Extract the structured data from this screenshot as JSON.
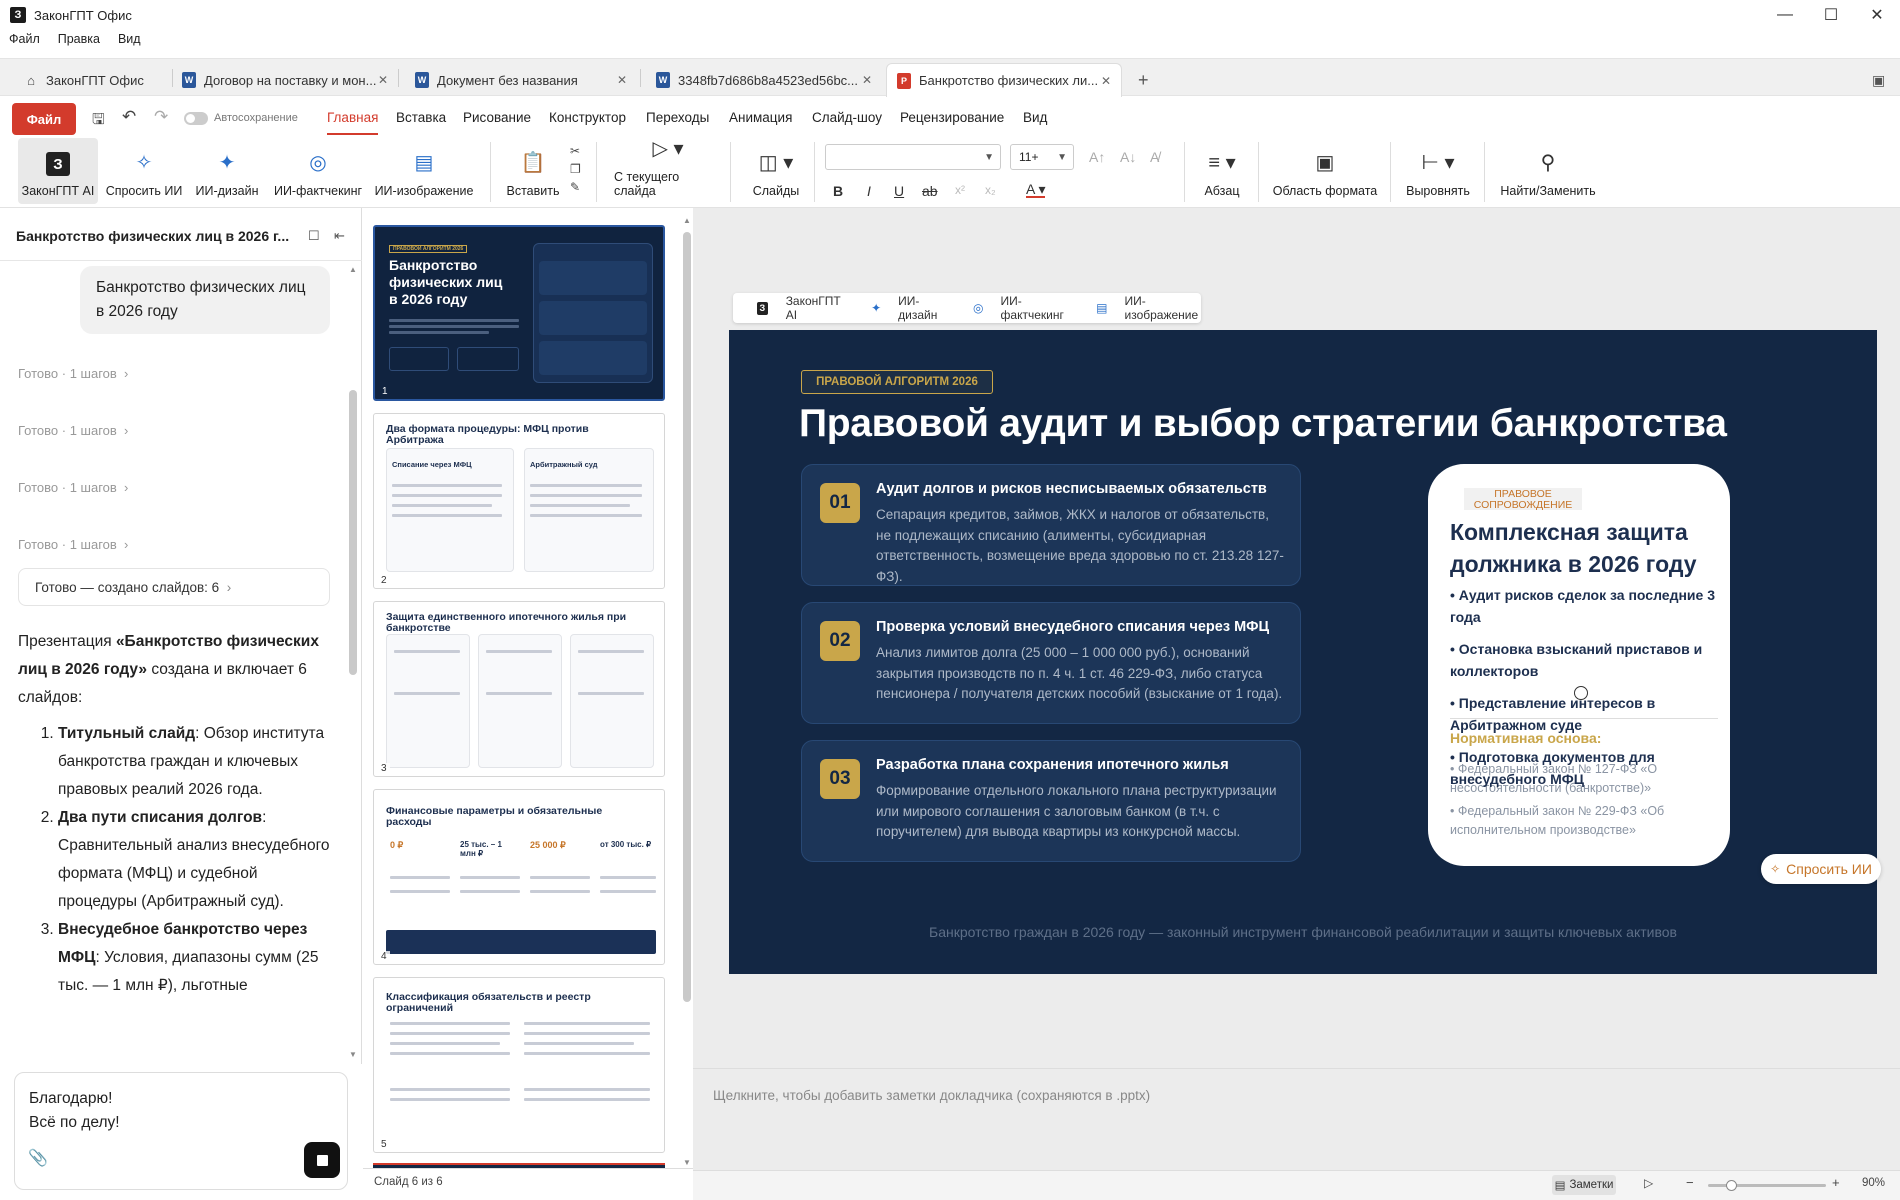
{
  "window": {
    "logo": "З",
    "title": "ЗаконГПТ Офис"
  },
  "menu": [
    "Файл",
    "Правка",
    "Вид"
  ],
  "tabs": [
    {
      "label": "ЗаконГПТ Офис",
      "icon": "home-icon"
    },
    {
      "label": "Договор на поставку и мон...",
      "icon": "word-doc-icon"
    },
    {
      "label": "Документ без названия",
      "icon": "word-doc-icon"
    },
    {
      "label": "3348fb7d686b8a4523ed56bc...",
      "icon": "word-doc-icon"
    },
    {
      "label": "Банкротство физических ли...",
      "icon": "presentation-icon"
    }
  ],
  "ribbon_top": {
    "file": "Файл",
    "autosave": "Автосохранение",
    "tabs": [
      "Главная",
      "Вставка",
      "Рисование",
      "Конструктор",
      "Переходы",
      "Анимация",
      "Слайд-шоу",
      "Рецензирование",
      "Вид"
    ]
  },
  "ribbon": {
    "ai_logo": "З",
    "zakon_ai": "ЗаконГПТ AI",
    "ask_ai": "Спросить ИИ",
    "ai_design": "ИИ-дизайн",
    "ai_factcheck": "ИИ-фактчекинг",
    "ai_image": "ИИ-изображение",
    "paste": "Вставить",
    "from_current": "С текущего слайда",
    "slides": "Слайды",
    "font_size": "11+",
    "paragraph": "Абзац",
    "format_area": "Область формата",
    "align": "Выровнять",
    "find_replace": "Найти/Заменить"
  },
  "chat": {
    "title": "Банкротство физических лиц в 2026 г...",
    "user_message": "Банкротство физических лиц в 2026 году",
    "steps": [
      "Готово · 1 шагов",
      "Готово · 1 шагов",
      "Готово · 1 шагов",
      "Готово · 1 шагов"
    ],
    "done": "Готово — создано слайдов: 6",
    "intro_before": "Презентация ",
    "intro_bold": "«Банкротство физических лиц в 2026 году»",
    "intro_after": " создана и включает 6 слайдов:",
    "items": [
      {
        "bold": "Титульный слайд",
        "text": ": Обзор института банкротства граждан и ключевых правовых реалий 2026 года."
      },
      {
        "bold": "Два пути списания долгов",
        "text": ": Сравнительный анализ внесудебного формата (МФЦ) и судебной процедуры (Арбитражный суд)."
      },
      {
        "bold": "Внесудебное банкротство через МФЦ",
        "text": ": Условия, диапазоны сумм (25 тыс. — 1 млн ₽), льготные"
      }
    ],
    "input_line1": "Благодарю!",
    "input_line2": "Всё по делу!"
  },
  "thumbnails": {
    "numbers": [
      "1",
      "2",
      "3",
      "4",
      "5"
    ],
    "t1_badge": "ПРАВОВОЙ АЛГОРИТМ 2026",
    "t1_title": "Банкротство физических лиц в 2026 году",
    "t2_title": "Два формата процедуры: МФЦ против Арбитража",
    "t2_left": "Списание через МФЦ",
    "t2_right": "Арбитражный суд",
    "t3_title": "Защита единственного ипотечного жилья при банкротстве",
    "t4_title": "Финансовые параметры и обязательные расходы",
    "t4_values": [
      "0 ₽",
      "25 тыс. – 1 млн ₽",
      "25 000 ₽",
      "от 300 тыс. ₽"
    ],
    "t5_title": "Классификация обязательств и реестр ограничений",
    "status": "Слайд 6 из 6"
  },
  "floating_toolbar": [
    "ЗаконГПТ AI",
    "ИИ-дизайн",
    "ИИ-фактчекинг",
    "ИИ-изображение"
  ],
  "slide": {
    "badge": "ПРАВОВОЙ АЛГОРИТМ 2026",
    "title": "Правовой аудит и выбор стратегии банкротства",
    "cards": [
      {
        "num": "01",
        "title": "Аудит долгов и рисков несписываемых обязательств",
        "text": "Сепарация кредитов, займов, ЖКХ и налогов от обязательств, не подлежащих списанию (алименты, субсидиарная ответственность, возмещение вреда здоровью по ст. 213.28 127-ФЗ)."
      },
      {
        "num": "02",
        "title": "Проверка условий внесудебного списания через МФЦ",
        "text": "Анализ лимитов долга (25 000 – 1 000 000 руб.), оснований закрытия производств по п. 4 ч. 1 ст. 46 229-ФЗ, либо статуса пенсионера / получателя детских пособий (взыскание от 1 года)."
      },
      {
        "num": "03",
        "title": "Разработка плана сохранения ипотечного жилья",
        "text": "Формирование отдельного локального плана реструктуризации или мирового соглашения с залоговым банком (в т.ч. с поручителем) для вывода квартиры из конкурсной массы."
      }
    ],
    "right": {
      "badge": "ПРАВОВОЕ СОПРОВОЖДЕНИЕ",
      "title": "Комплексная защита должника в 2026 году",
      "b1": "• Аудит рисков сделок за последние 3 года",
      "b2": "• Остановка взысканий приставов и коллекторов",
      "b3": "• Представление интересов в Арбитражном суде",
      "norm": "Нормативная основа:",
      "b4": "• Подготовка документов для внесудебного МФЦ",
      "law1": "• Федеральный закон № 127-ФЗ «О несостоятельности (банкротстве)»",
      "law2": "• Федеральный закон № 229-ФЗ «Об исполнительном производстве»"
    },
    "footer": "Банкротство граждан в 2026 году — законный инструмент финансовой реабилитации и защиты ключевых активов"
  },
  "ask_ai_float": "Спросить ИИ",
  "notes_placeholder": "Щелкните, чтобы добавить заметки докладчика (сохраняются в .pptx)",
  "statusbar": {
    "notes": "Заметки",
    "minus": "−",
    "plus": "+",
    "zoom": "90%",
    "zoom_level": 0.2
  },
  "colors": {
    "accent": "#d33b2c",
    "slide_bg": "#132744",
    "gold": "#c9a64a"
  }
}
